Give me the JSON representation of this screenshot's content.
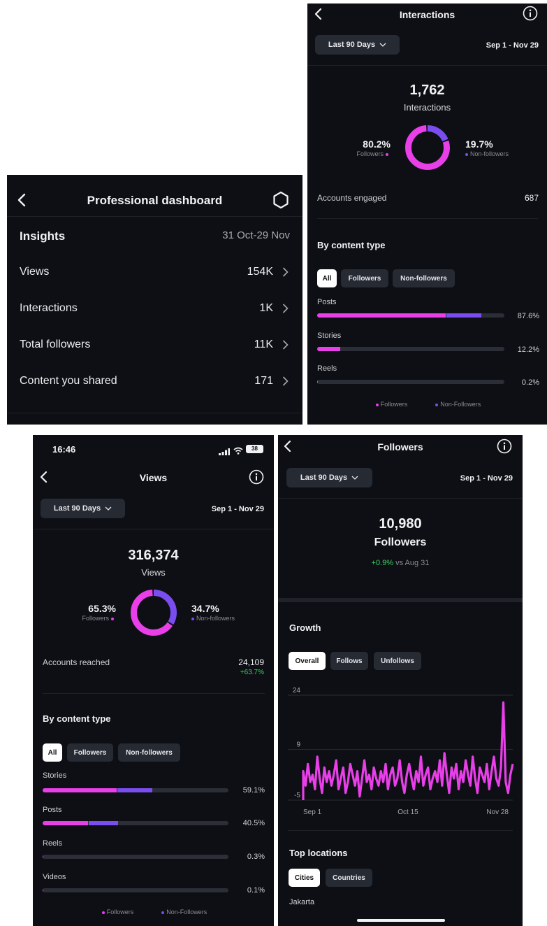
{
  "dashboard": {
    "title": "Professional dashboard",
    "insights_label": "Insights",
    "date_range": "31 Oct-29 Nov",
    "rows": [
      {
        "label": "Views",
        "value": "154K"
      },
      {
        "label": "Interactions",
        "value": "1K"
      },
      {
        "label": "Total followers",
        "value": "11K"
      },
      {
        "label": "Content you shared",
        "value": "171"
      }
    ]
  },
  "interactions": {
    "title": "Interactions",
    "range_button": "Last 90 Days",
    "date_range": "Sep 1 - Nov 29",
    "total": "1,762",
    "total_label": "Interactions",
    "followers_pct": "80.2%",
    "followers_label": "Followers",
    "nonfollowers_pct": "19.7%",
    "nonfollowers_label": "Non-followers",
    "followers_fraction": 0.802,
    "accounts_engaged_label": "Accounts engaged",
    "accounts_engaged_value": "687",
    "by_content_type": "By content type",
    "filters": [
      "All",
      "Followers",
      "Non-followers"
    ],
    "rows": [
      {
        "label": "Posts",
        "value": "87.6%",
        "followers": 0.687,
        "nonfollowers": 0.189
      },
      {
        "label": "Stories",
        "value": "12.2%",
        "followers": 0.122,
        "nonfollowers": 0.0
      },
      {
        "label": "Reels",
        "value": "0.2%",
        "followers": 0.002,
        "nonfollowers": 0.0
      }
    ],
    "legend_followers": "Followers",
    "legend_nonfollowers": "Non-Followers"
  },
  "views": {
    "status_time": "16:46",
    "battery": "38",
    "title": "Views",
    "range_button": "Last 90 Days",
    "date_range": "Sep 1 - Nov 29",
    "total": "316,374",
    "total_label": "Views",
    "followers_pct": "65.3%",
    "followers_label": "Followers",
    "nonfollowers_pct": "34.7%",
    "nonfollowers_label": "Non-followers",
    "followers_fraction": 0.653,
    "accounts_reached_label": "Accounts reached",
    "accounts_reached_value": "24,109",
    "accounts_reached_change": "+63.7%",
    "by_content_type": "By content type",
    "filters": [
      "All",
      "Followers",
      "Non-followers"
    ],
    "rows": [
      {
        "label": "Stories",
        "value": "59.1%",
        "followers": 0.4,
        "nonfollowers": 0.191
      },
      {
        "label": "Posts",
        "value": "40.5%",
        "followers": 0.245,
        "nonfollowers": 0.16
      },
      {
        "label": "Reels",
        "value": "0.3%",
        "followers": 0.003,
        "nonfollowers": 0.0
      },
      {
        "label": "Videos",
        "value": "0.1%",
        "followers": 0.001,
        "nonfollowers": 0.0
      }
    ],
    "legend_followers": "Followers",
    "legend_nonfollowers": "Non-Followers"
  },
  "followers": {
    "title": "Followers",
    "range_button": "Last 90 Days",
    "date_range": "Sep 1 - Nov 29",
    "total": "10,980",
    "total_label": "Followers",
    "change": "+0.9%",
    "change_suffix": "vs Aug 31",
    "growth_label": "Growth",
    "growth_filters": [
      "Overall",
      "Follows",
      "Unfollows"
    ],
    "top_locations_label": "Top locations",
    "location_filters": [
      "Cities",
      "Countries"
    ],
    "first_location": "Jakarta"
  },
  "chart_data": {
    "type": "area",
    "title": "Growth",
    "x_tick_labels": [
      "Sep 1",
      "Oct 15",
      "Nov 28"
    ],
    "y_tick_labels": [
      "24",
      "9",
      "-5"
    ],
    "ylim": [
      -5,
      24
    ],
    "grid": true,
    "color": "#e83fe9",
    "series": [
      {
        "values": [
          3,
          -1,
          5,
          0,
          2,
          -2,
          7,
          1,
          -3,
          4,
          0,
          3,
          -1,
          2,
          6,
          -2,
          1,
          4,
          -3,
          0,
          5,
          2,
          -1,
          3,
          -4,
          1,
          6,
          0,
          2,
          -2,
          4,
          1,
          -1,
          3,
          0,
          5,
          -2,
          2,
          4,
          -1,
          1,
          6,
          0,
          -3,
          2,
          5,
          1,
          -2,
          3,
          0,
          7,
          -1,
          2,
          4,
          -2,
          1,
          3,
          0,
          6,
          -1,
          8,
          2,
          -3,
          4,
          1,
          5,
          -2,
          3,
          0,
          6,
          2,
          -1,
          7,
          1,
          -3,
          4,
          2,
          0,
          5,
          -2,
          3,
          7,
          1,
          -1,
          4,
          22,
          0,
          -3,
          2,
          5
        ]
      }
    ]
  }
}
